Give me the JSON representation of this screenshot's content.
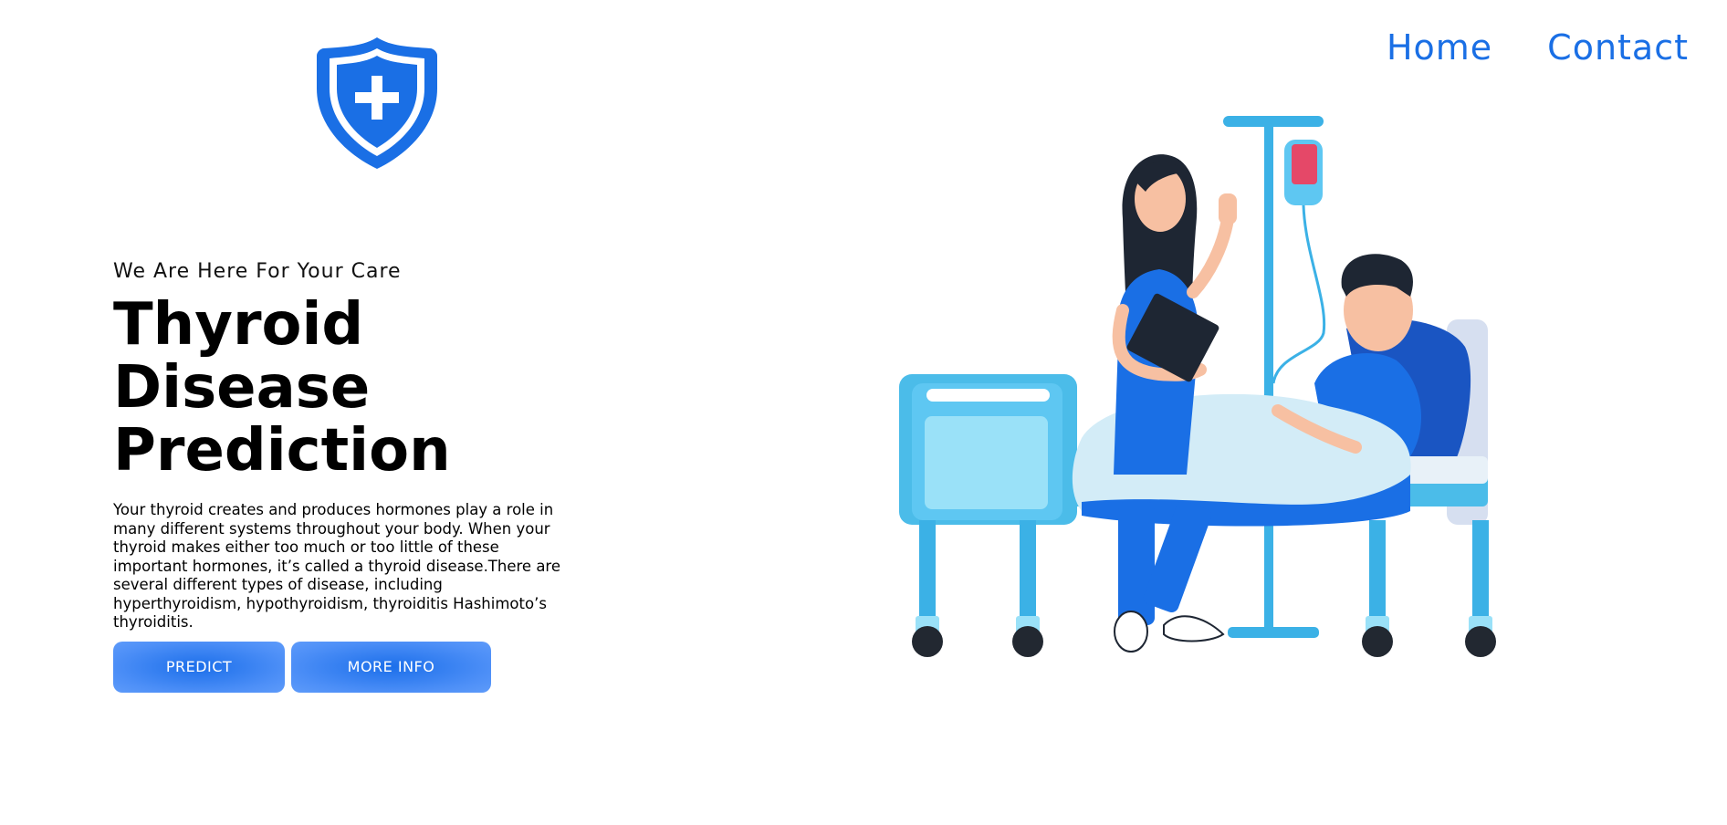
{
  "header": {
    "logo_icon": "shield-plus-icon",
    "nav": [
      {
        "label": "Home"
      },
      {
        "label": "Contact"
      }
    ]
  },
  "hero": {
    "tagline": "We Are Here For Your Care",
    "title_line1": "Thyroid Disease",
    "title_line2": "Prediction",
    "description": "Your thyroid creates and produces hormones play a role in many different systems throughout your body. When your thyroid makes either too much or too little of these important hormones, it’s called a thyroid disease.There are several different types of disease, including hyperthyroidism, hypothyroidism, thyroiditis Hashimoto’s thyroiditis.",
    "buttons": {
      "predict": "PREDICT",
      "more_info": "MORE INFO"
    }
  },
  "illustration": {
    "icon": "hospital-bed-illustration"
  },
  "colors": {
    "accent": "#1a6fe5",
    "button_start": "#1c6fea",
    "button_end": "#5e9bfa"
  }
}
